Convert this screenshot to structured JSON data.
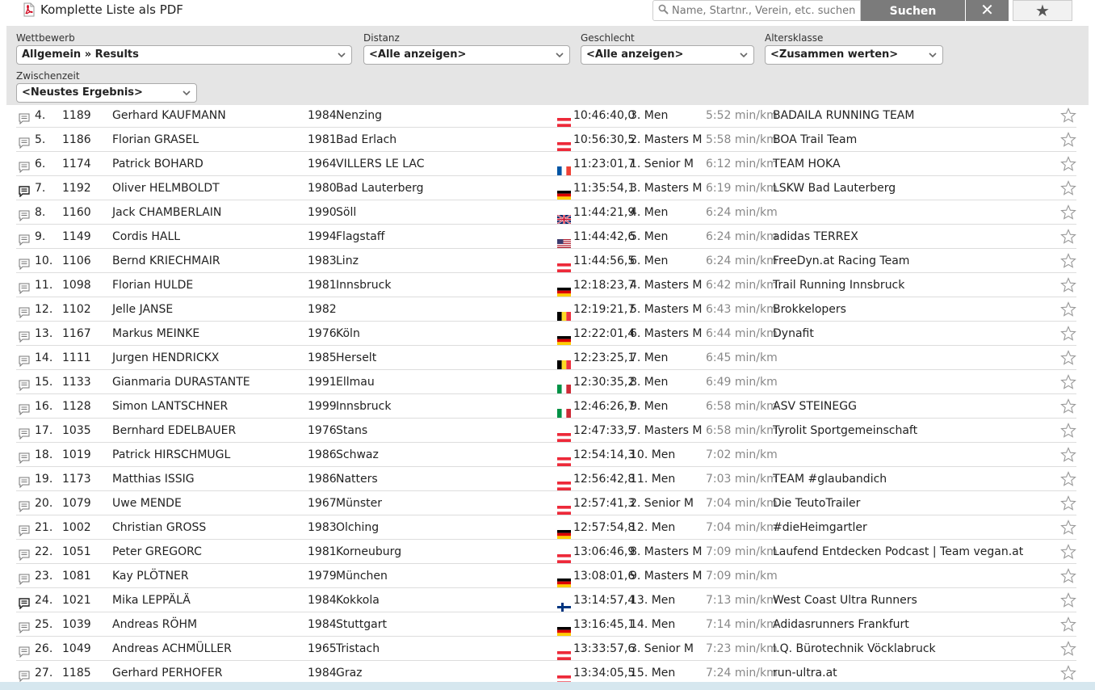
{
  "toolbar": {
    "pdf_label": "Komplette Liste als PDF",
    "search_placeholder": "Name, Startnr., Verein, etc. suchen",
    "search_button": "Suchen",
    "clear_symbol": "✕",
    "favorite_symbol": "★"
  },
  "filters": {
    "competition": {
      "label": "Wettbewerb",
      "value": "Allgemein » Results"
    },
    "distance": {
      "label": "Distanz",
      "value": "<Alle anzeigen>"
    },
    "gender": {
      "label": "Geschlecht",
      "value": "<Alle anzeigen>"
    },
    "age_class": {
      "label": "Altersklasse",
      "value": "<Zusammen werten>"
    },
    "split": {
      "label": "Zwischenzeit",
      "value": "<Neustes Ergebnis>"
    }
  },
  "colors": {
    "filter_bg": "#e5e5e5",
    "button_bg": "#7b7b7b",
    "pace_text": "#888888"
  },
  "rows": [
    {
      "rank": "4.",
      "bib": "1189",
      "name": "Gerhard KAUFMANN",
      "year": "1984",
      "city": "Nenzing",
      "flag": "AT",
      "time": "10:46:40,0",
      "cat": "3. Men",
      "pace": "5:52 min/km",
      "club": "BADAILA RUNNING TEAM",
      "comment": "outline"
    },
    {
      "rank": "5.",
      "bib": "1186",
      "name": "Florian GRASEL",
      "year": "1981",
      "city": "Bad Erlach",
      "flag": "AT",
      "time": "10:56:30,5",
      "cat": "2. Masters M",
      "pace": "5:58 min/km",
      "club": "BOA Trail Team",
      "comment": "outline"
    },
    {
      "rank": "6.",
      "bib": "1174",
      "name": "Patrick BOHARD",
      "year": "1964",
      "city": "VILLERS LE LAC",
      "flag": "FR",
      "time": "11:23:01,7",
      "cat": "1. Senior M",
      "pace": "6:12 min/km",
      "club": "TEAM HOKA",
      "comment": "outline"
    },
    {
      "rank": "7.",
      "bib": "1192",
      "name": "Oliver HELMBOLDT",
      "year": "1980",
      "city": "Bad Lauterberg",
      "flag": "DE",
      "time": "11:35:54,1",
      "cat": "3. Masters M",
      "pace": "6:19 min/km",
      "club": "LSKW Bad Lauterberg",
      "comment": "filled"
    },
    {
      "rank": "8.",
      "bib": "1160",
      "name": "Jack CHAMBERLAIN",
      "year": "1990",
      "city": "Söll",
      "flag": "GB",
      "time": "11:44:21,9",
      "cat": "4. Men",
      "pace": "6:24 min/km",
      "club": "",
      "comment": "outline"
    },
    {
      "rank": "9.",
      "bib": "1149",
      "name": "Cordis HALL",
      "year": "1994",
      "city": "Flagstaff",
      "flag": "US",
      "time": "11:44:42,6",
      "cat": "5. Men",
      "pace": "6:24 min/km",
      "club": "adidas TERREX",
      "comment": "outline"
    },
    {
      "rank": "10.",
      "bib": "1106",
      "name": "Bernd KRIECHMAIR",
      "year": "1983",
      "city": "Linz",
      "flag": "AT",
      "time": "11:44:56,5",
      "cat": "6. Men",
      "pace": "6:24 min/km",
      "club": "FreeDyn.at Racing Team",
      "comment": "outline"
    },
    {
      "rank": "11.",
      "bib": "1098",
      "name": "Florian HULDE",
      "year": "1981",
      "city": "Innsbruck",
      "flag": "DE",
      "time": "12:18:23,7",
      "cat": "4. Masters M",
      "pace": "6:42 min/km",
      "club": "Trail Running Innsbruck",
      "comment": "outline"
    },
    {
      "rank": "12.",
      "bib": "1102",
      "name": "Jelle JANSE",
      "year": "1982",
      "city": "",
      "flag": "BE",
      "time": "12:19:21,7",
      "cat": "5. Masters M",
      "pace": "6:43 min/km",
      "club": "Brokkelopers",
      "comment": "outline"
    },
    {
      "rank": "13.",
      "bib": "1167",
      "name": "Markus MEINKE",
      "year": "1976",
      "city": "Köln",
      "flag": "DE",
      "time": "12:22:01,4",
      "cat": "6. Masters M",
      "pace": "6:44 min/km",
      "club": "Dynafit",
      "comment": "outline"
    },
    {
      "rank": "14.",
      "bib": "1111",
      "name": "Jurgen HENDRICKX",
      "year": "1985",
      "city": "Herselt",
      "flag": "BE",
      "time": "12:23:25,1",
      "cat": "7. Men",
      "pace": "6:45 min/km",
      "club": "",
      "comment": "outline"
    },
    {
      "rank": "15.",
      "bib": "1133",
      "name": "Gianmaria DURASTANTE",
      "year": "1991",
      "city": "Ellmau",
      "flag": "IT",
      "time": "12:30:35,2",
      "cat": "8. Men",
      "pace": "6:49 min/km",
      "club": "",
      "comment": "outline"
    },
    {
      "rank": "16.",
      "bib": "1128",
      "name": "Simon LANTSCHNER",
      "year": "1999",
      "city": "Innsbruck",
      "flag": "IT",
      "time": "12:46:26,7",
      "cat": "9. Men",
      "pace": "6:58 min/km",
      "club": "ASV STEINEGG",
      "comment": "outline"
    },
    {
      "rank": "17.",
      "bib": "1035",
      "name": "Bernhard EDELBAUER",
      "year": "1976",
      "city": "Stans",
      "flag": "AT",
      "time": "12:47:33,5",
      "cat": "7. Masters M",
      "pace": "6:58 min/km",
      "club": "Tyrolit Sportgemeinschaft",
      "comment": "outline"
    },
    {
      "rank": "18.",
      "bib": "1019",
      "name": "Patrick HIRSCHMUGL",
      "year": "1986",
      "city": "Schwaz",
      "flag": "AT",
      "time": "12:54:14,3",
      "cat": "10. Men",
      "pace": "7:02 min/km",
      "club": "",
      "comment": "outline"
    },
    {
      "rank": "19.",
      "bib": "1173",
      "name": "Matthias ISSIG",
      "year": "1986",
      "city": "Natters",
      "flag": "AT",
      "time": "12:56:42,8",
      "cat": "11. Men",
      "pace": "7:03 min/km",
      "club": "TEAM #glaubandich",
      "comment": "outline"
    },
    {
      "rank": "20.",
      "bib": "1079",
      "name": "Uwe MENDE",
      "year": "1967",
      "city": "Münster",
      "flag": "AT",
      "time": "12:57:41,3",
      "cat": "2. Senior M",
      "pace": "7:04 min/km",
      "club": "Die TeutoTrailer",
      "comment": "outline"
    },
    {
      "rank": "21.",
      "bib": "1002",
      "name": "Christian GROSS",
      "year": "1983",
      "city": "Olching",
      "flag": "DE",
      "time": "12:57:54,8",
      "cat": "12. Men",
      "pace": "7:04 min/km",
      "club": "#dieHeimgartler",
      "comment": "outline"
    },
    {
      "rank": "22.",
      "bib": "1051",
      "name": "Peter GREGORC",
      "year": "1981",
      "city": "Korneuburg",
      "flag": "AT",
      "time": "13:06:46,9",
      "cat": "8. Masters M",
      "pace": "7:09 min/km",
      "club": "Laufend Entdecken Podcast | Team vegan.at",
      "comment": "outline"
    },
    {
      "rank": "23.",
      "bib": "1081",
      "name": "Kay PLÖTNER",
      "year": "1979",
      "city": "München",
      "flag": "DE",
      "time": "13:08:01,6",
      "cat": "9. Masters M",
      "pace": "7:09 min/km",
      "club": "",
      "comment": "outline"
    },
    {
      "rank": "24.",
      "bib": "1021",
      "name": "Mika LEPPÄLÄ",
      "year": "1984",
      "city": "Kokkola",
      "flag": "FI",
      "time": "13:14:57,4",
      "cat": "13. Men",
      "pace": "7:13 min/km",
      "club": "West Coast Ultra Runners",
      "comment": "filled"
    },
    {
      "rank": "25.",
      "bib": "1039",
      "name": "Andreas RÖHM",
      "year": "1984",
      "city": "Stuttgart",
      "flag": "DE",
      "time": "13:16:45,1",
      "cat": "14. Men",
      "pace": "7:14 min/km",
      "club": "Adidasrunners Frankfurt",
      "comment": "outline"
    },
    {
      "rank": "26.",
      "bib": "1049",
      "name": "Andreas ACHMÜLLER",
      "year": "1965",
      "city": "Tristach",
      "flag": "AT",
      "time": "13:33:57,6",
      "cat": "3. Senior M",
      "pace": "7:23 min/km",
      "club": "I.Q. Bürotechnik Vöcklabruck",
      "comment": "outline"
    },
    {
      "rank": "27.",
      "bib": "1185",
      "name": "Gerhard PERHOFER",
      "year": "1984",
      "city": "Graz",
      "flag": "AT",
      "time": "13:34:05,5",
      "cat": "15. Men",
      "pace": "7:24 min/km",
      "club": "run-ultra.at",
      "comment": "outline"
    }
  ]
}
